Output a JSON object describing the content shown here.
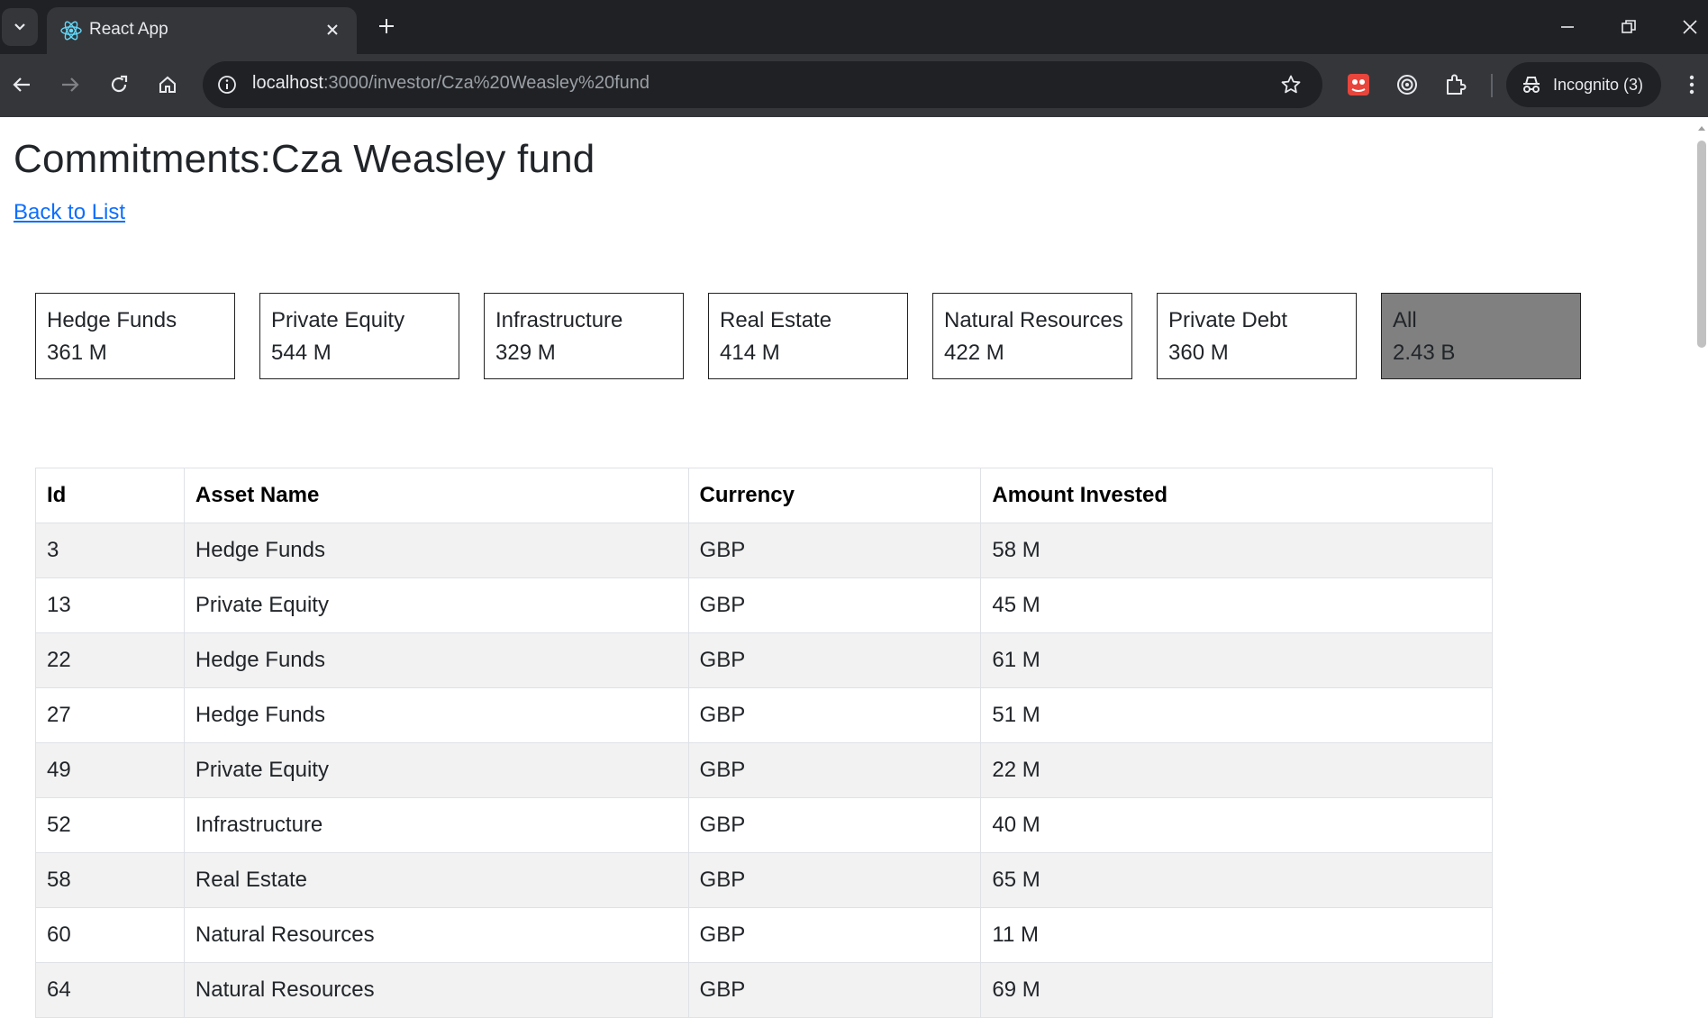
{
  "browser": {
    "tab_title": "React App",
    "url_host": "localhost",
    "url_path": ":3000/investor/Cza%20Weasley%20fund",
    "incognito_label": "Incognito (3)"
  },
  "page": {
    "title": "Commitments:Cza Weasley fund",
    "back_link": "Back to List"
  },
  "cards": [
    {
      "name": "Hedge Funds",
      "value": "361 M",
      "selected": false
    },
    {
      "name": "Private Equity",
      "value": "544 M",
      "selected": false
    },
    {
      "name": "Infrastructure",
      "value": "329 M",
      "selected": false
    },
    {
      "name": "Real Estate",
      "value": "414 M",
      "selected": false
    },
    {
      "name": "Natural Resources",
      "value": "422 M",
      "selected": false
    },
    {
      "name": "Private Debt",
      "value": "360 M",
      "selected": false
    },
    {
      "name": "All",
      "value": "2.43 B",
      "selected": true
    }
  ],
  "table": {
    "headers": [
      "Id",
      "Asset Name",
      "Currency",
      "Amount Invested"
    ],
    "rows": [
      [
        "3",
        "Hedge Funds",
        "GBP",
        "58 M"
      ],
      [
        "13",
        "Private Equity",
        "GBP",
        "45 M"
      ],
      [
        "22",
        "Hedge Funds",
        "GBP",
        "61 M"
      ],
      [
        "27",
        "Hedge Funds",
        "GBP",
        "51 M"
      ],
      [
        "49",
        "Private Equity",
        "GBP",
        "22 M"
      ],
      [
        "52",
        "Infrastructure",
        "GBP",
        "40 M"
      ],
      [
        "58",
        "Real Estate",
        "GBP",
        "65 M"
      ],
      [
        "60",
        "Natural Resources",
        "GBP",
        "11 M"
      ],
      [
        "64",
        "Natural Resources",
        "GBP",
        "69 M"
      ]
    ]
  },
  "icons": {
    "tab_dropdown": "chevron-down-icon",
    "favicon": "react-icon",
    "close": "close-icon",
    "new_tab": "plus-icon",
    "back": "arrow-left-icon",
    "forward": "arrow-right-icon",
    "reload": "reload-icon",
    "home": "home-icon",
    "site_info": "info-icon",
    "bookmark": "star-icon",
    "extensions": "puzzle-icon"
  },
  "colors": {
    "link": "#0d6efd",
    "selected_card": "#808080",
    "row_stripe": "#f2f2f2"
  }
}
